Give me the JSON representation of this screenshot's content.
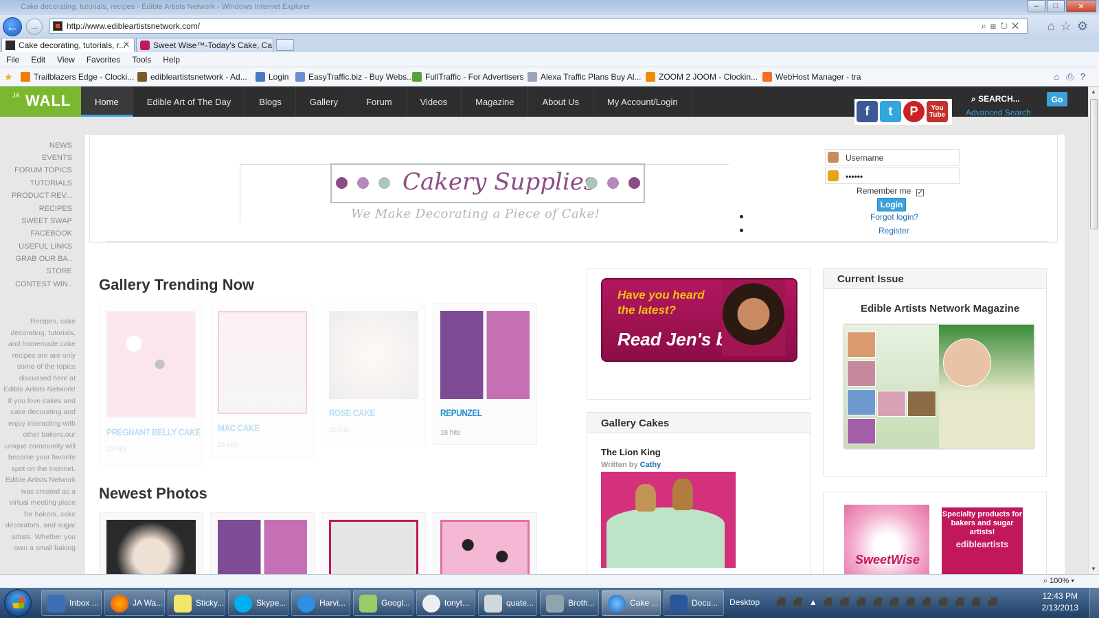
{
  "window": {
    "title": "Cake decorating, tutorials, recipes - Edible Artists Network - Windows Internet Explorer"
  },
  "address": {
    "url": "http://www.edibleartistsnetwork.com/"
  },
  "tabs": [
    {
      "label": "Cake decorating, tutorials, r...",
      "active": true
    },
    {
      "label": "Sweet Wise™-Today's Cake, Ca...",
      "active": false
    }
  ],
  "menu": [
    "File",
    "Edit",
    "View",
    "Favorites",
    "Tools",
    "Help"
  ],
  "favorites": [
    "Trailblazers Edge - Clocki...",
    "edibleartistsnetwork - Ad...",
    "Login",
    "EasyTraffic.biz - Buy Webs...",
    "FullTraffic - For Advertisers",
    "Alexa Traffic Plans  Buy Al...",
    "ZOOM 2 JOOM - Clockin...",
    "WebHost Manager - tra"
  ],
  "site": {
    "logo_ja": "JA",
    "logo_wall": "WALL",
    "nav": [
      "Home",
      "Edible Art of The Day",
      "Blogs",
      "Gallery",
      "Forum",
      "Videos",
      "Magazine",
      "About Us",
      "My Account/Login"
    ],
    "search_label": "SEARCH...",
    "advanced_search": "Advanced Search",
    "go": "Go",
    "social": [
      "f",
      "t",
      "P",
      "You Tube"
    ]
  },
  "sidebar": {
    "items": [
      "NEWS",
      "EVENTS",
      "FORUM TOPICS",
      "TUTORIALS",
      "PRODUCT REV...",
      "RECIPES",
      "SWEET SWAP",
      "FACEBOOK",
      "USEFUL LINKS",
      "GRAB OUR BA..",
      "STORE",
      "CONTEST WIN.."
    ],
    "blurb": "Recipes, cake decorating, tutorials, and homemade cake recipes are are only some of the topics discussed here at Edible Artists Network! If you love cakes and cake decorating and enjoy interacting with other bakers,our unique community will become your favorite spot on the Internet. Edible Artists Network was created as a virtual meeting place for bakers, cake decorators, and sugar artists. Whether you own a small baking"
  },
  "banner": {
    "title": "Cakery Supplies",
    "tagline": "We Make Decorating a Piece of Cake!"
  },
  "login": {
    "username": "Username",
    "password": "••••••",
    "remember": "Remember me",
    "button": "Login",
    "forgot": "Forgot login?",
    "register": "Register"
  },
  "gallery": {
    "heading": "Gallery Trending Now",
    "items": [
      {
        "title": "PREGNANT BELLY CAKE",
        "hits": "23 hits"
      },
      {
        "title": "MAC CAKE",
        "hits": "26 hits"
      },
      {
        "title": "ROSE CAKE",
        "hits": "20 hits"
      },
      {
        "title": "REPUNZEL",
        "hits": "18 hits"
      }
    ]
  },
  "newest": {
    "heading": "Newest Photos"
  },
  "jen_ad": {
    "line1": "Have you heard",
    "line2": "the latest?",
    "line3": "Read Jen's blog!"
  },
  "gallery_cakes": {
    "heading": "Gallery Cakes",
    "item_title": "The Lion King",
    "written_by": "Written by",
    "author": "Cathy"
  },
  "current_issue": {
    "heading": "Current Issue",
    "magazine": "Edible Artists Network Magazine"
  },
  "ads": {
    "sweetwise": "SweetWise",
    "specialty": "Specialty products for bakers and sugar artists!",
    "brand": "edibleartists"
  },
  "status": {
    "zoom": "100%"
  },
  "taskbar": {
    "buttons": [
      "Inbox ...",
      "JA Wa...",
      "Sticky...",
      "Skype...",
      "Harvi...",
      "Googl...",
      "tonyt...",
      "quate...",
      "Broth...",
      "Cake ...",
      "Docu..."
    ],
    "desktop": "Desktop",
    "time": "12:43 PM",
    "date": "2/13/2013"
  }
}
